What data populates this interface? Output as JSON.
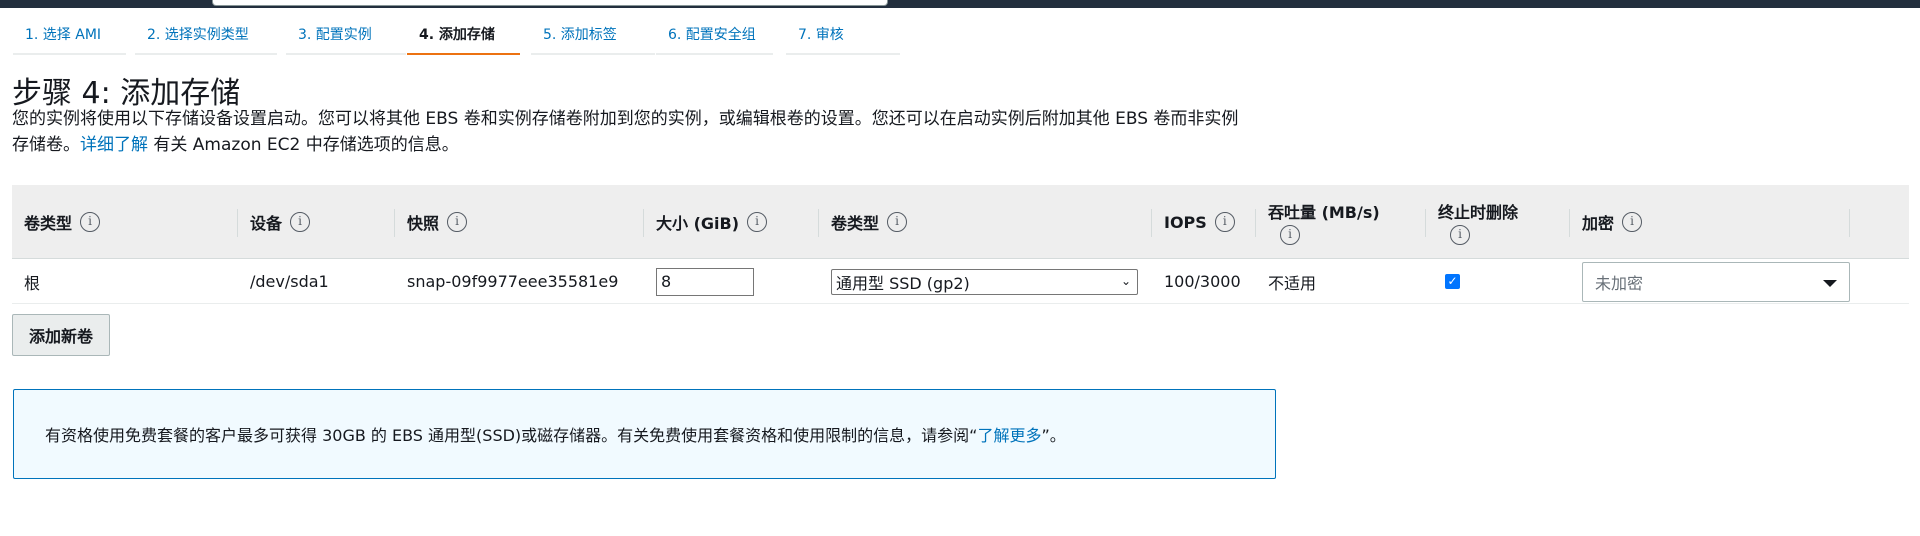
{
  "steps": [
    {
      "label": "1. 选择 AMI",
      "active": false
    },
    {
      "label": "2. 选择实例类型",
      "active": false
    },
    {
      "label": "3. 配置实例",
      "active": false
    },
    {
      "label": "4. 添加存储",
      "active": true
    },
    {
      "label": "5. 添加标签",
      "active": false
    },
    {
      "label": "6. 配置安全组",
      "active": false
    },
    {
      "label": "7. 审核",
      "active": false
    }
  ],
  "page": {
    "title": "步骤 4: 添加存储",
    "desc_line1": "您的实例将使用以下存储设备设置启动。您可以将其他 EBS 卷和实例存储卷附加到您的实例，或编辑根卷的设置。您还可以在启动实例后附加其他 EBS 卷而非实例",
    "desc_prefix": "存储卷。",
    "desc_link": "详细了解",
    "desc_suffix": " 有关 Amazon EC2 中存储选项的信息。"
  },
  "table": {
    "headers": {
      "volume_type": "卷类型",
      "device": "设备",
      "snapshot": "快照",
      "size": "大小 (GiB)",
      "ebs_type": "卷类型",
      "iops": "IOPS",
      "throughput": "吞吐量 (MB/s)",
      "delete_on_termination": "终止时删除",
      "encryption": "加密"
    },
    "info_glyph": "i",
    "row": {
      "volume_type": "根",
      "device": "/dev/sda1",
      "snapshot": "snap-09f9977eee35581e9",
      "size": "8",
      "ebs_type": "通用型 SSD (gp2)",
      "iops": "100/3000",
      "throughput": "不适用",
      "delete_on_termination_checked": true,
      "encryption": "未加密"
    }
  },
  "buttons": {
    "add_volume": "添加新卷"
  },
  "alert": {
    "text_prefix": "有资格使用免费套餐的客户最多可获得 30GB 的 EBS 通用型(SSD)或磁存储器。有关免费使用套餐资格和使用限制的信息，请参阅“",
    "link": "了解更多",
    "text_suffix": "”。"
  }
}
